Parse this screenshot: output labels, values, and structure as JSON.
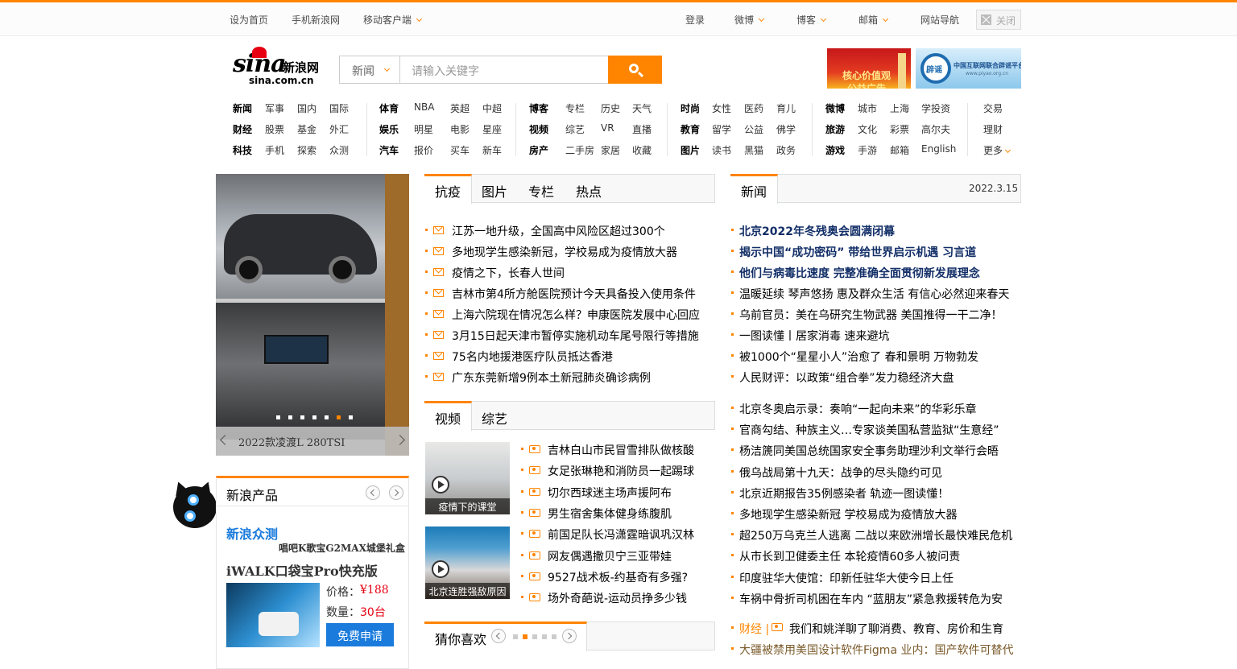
{
  "topbar": {
    "set_home": "设为首页",
    "mobile_sina": "手机新浪网",
    "mobile_client": "移动客户端",
    "login": "登录",
    "weibo": "微博",
    "blog": "博客",
    "mail": "邮箱",
    "site_nav": "网站导航",
    "close": "关闭"
  },
  "logo": {
    "brand": "sina",
    "name": "新浪网",
    "domain": "sina.com.cn"
  },
  "search": {
    "category": "新闻",
    "placeholder": "请输入关键字"
  },
  "ads": {
    "ad1_text": "核心价值观\n公益广告",
    "ad2_badge": "辟谣",
    "ad2_text": "中国互联网联合辟谣平台",
    "ad2_url": "www.piyao.org.cn"
  },
  "nav": {
    "col1": [
      [
        "新闻",
        "军事",
        "国内",
        "国际"
      ],
      [
        "财经",
        "股票",
        "基金",
        "外汇"
      ],
      [
        "科技",
        "手机",
        "探索",
        "众测"
      ]
    ],
    "col2": [
      [
        "体育",
        "NBA",
        "英超",
        "中超"
      ],
      [
        "娱乐",
        "明星",
        "电影",
        "星座"
      ],
      [
        "汽车",
        "报价",
        "买车",
        "新车"
      ]
    ],
    "col3": [
      [
        "博客",
        "专栏",
        "历史",
        "天气"
      ],
      [
        "视频",
        "综艺",
        "VR",
        "直播"
      ],
      [
        "房产",
        "二手房",
        "家居",
        "收藏"
      ]
    ],
    "col4": [
      [
        "时尚",
        "女性",
        "医药",
        "育儿"
      ],
      [
        "教育",
        "留学",
        "公益",
        "佛学"
      ],
      [
        "图片",
        "读书",
        "黑猫",
        "政务"
      ]
    ],
    "col5": [
      [
        "微博",
        "城市",
        "上海",
        "学投资"
      ],
      [
        "旅游",
        "文化",
        "彩票",
        "高尔夫"
      ],
      [
        "游戏",
        "手游",
        "邮箱",
        "English"
      ]
    ],
    "col6": [
      "交易",
      "理财",
      "更多"
    ]
  },
  "slideshow": {
    "caption": "2022款凌渡L 280TSI"
  },
  "epidemic": {
    "tabs": [
      "抗疫",
      "图片",
      "专栏",
      "热点"
    ],
    "items": [
      "江苏一地升级，全国高中风险区超过300个",
      "多地现学生感染新冠，学校易成为疫情放大器",
      "疫情之下，长春人世间",
      "吉林市第4所方舱医院预计今天具备投入使用条件",
      "上海六院现在情况怎么样？申康医院发展中心回应",
      "3月15日起天津市暂停实施机动车尾号限行等措施",
      "75名内地援港医疗队员抵达香港",
      "广东东莞新增9例本土新冠肺炎确诊病例"
    ]
  },
  "video": {
    "tabs": [
      "视频",
      "综艺"
    ],
    "thumbs": [
      "疫情下的课堂",
      "北京连胜强敌原因"
    ],
    "items": [
      "吉林白山市民冒雪排队做核酸",
      "女足张琳艳和消防员一起踢球",
      "切尔西球迷主场声援阿布",
      "男生宿舍集体健身练腹肌",
      "前国足队长冯潇霆暗讽巩汉林",
      "网友偶遇撒贝宁三亚带娃",
      "9527战术板-约基奇有多强?",
      "场外奇葩说-运动员挣多少钱"
    ]
  },
  "guess": {
    "title": "猜你喜欢"
  },
  "news": {
    "tab": "新闻",
    "date": "2022.3.15",
    "headlines": [
      "北京2022年冬残奥会圆满闭幕",
      "揭示中国“成功密码” 带给世界启示机遇 习言道",
      "他们与病毒比速度 完整准确全面贯彻新发展理念"
    ],
    "items1": [
      "温暖延续 琴声悠扬 惠及群众生活 有信心必然迎来春天",
      "乌前官员：美在乌研究生物武器 美国推得一干二净！",
      "一图读懂丨居家消毒 速来避坑",
      "被1000个“星星小人”治愈了 春和景明 万物勃发",
      "人民财评：以政策“组合拳”发力稳经济大盘"
    ],
    "items2": [
      "北京冬奥启示录：奏响“一起向未来”的华彩乐章",
      "官商勾结、种族主义…专家谈美国私营监狱“生意经”",
      "杨洁篪同美国总统国家安全事务助理沙利文举行会晤",
      "俄乌战局第十九天：战争的尽头隐约可见",
      "北京近期报告35例感染者 轨迹一图读懂！",
      "多地现学生感染新冠 学校易成为疫情放大器",
      "超250万乌克兰人逃离 二战以来欧洲增长最快难民危机",
      "从市长到卫健委主任 本轮疫情60多人被问责",
      "印度驻华大使馆：印新任驻华大使今日上任",
      "车祸中骨折司机困在车内 “蓝朋友”紧急救援转危为安"
    ],
    "finance_label": "财经 |",
    "finance_item": "我们和姚洋聊了聊消费、教育、房价和生育",
    "last_item": "大疆被禁用美国设计软件Figma 业内：国产软件可替代"
  },
  "products": {
    "title": "新浪产品",
    "zhongce": "新浪众测",
    "promo": "唱吧K歌宝G2MAX城堡礼盒",
    "product_name": "iWALK口袋宝Pro快充版",
    "price_label": "价格：",
    "price": "¥188",
    "qty_label": "数量：",
    "qty": "30台",
    "apply": "免费申请"
  },
  "colors": {
    "accent": "#ff8400",
    "headline": "#122e67",
    "blue": "#1a7bdc",
    "red": "#e60012"
  }
}
